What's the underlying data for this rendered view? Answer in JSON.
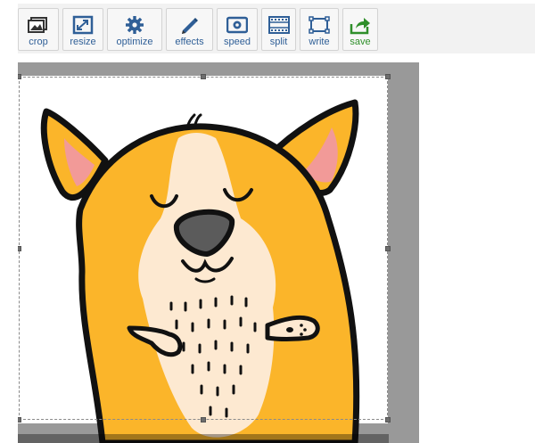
{
  "toolbar": {
    "tools": [
      {
        "id": "crop",
        "label": "crop",
        "icon": "crop-image-icon"
      },
      {
        "id": "resize",
        "label": "resize",
        "icon": "resize-arrows-icon"
      },
      {
        "id": "optimize",
        "label": "optimize",
        "icon": "gear-icon"
      },
      {
        "id": "effects",
        "label": "effects",
        "icon": "pencil-icon"
      },
      {
        "id": "speed",
        "label": "speed",
        "icon": "play-speed-icon"
      },
      {
        "id": "split",
        "label": "split",
        "icon": "film-strip-icon"
      },
      {
        "id": "write",
        "label": "write",
        "icon": "text-frame-icon"
      },
      {
        "id": "save",
        "label": "save",
        "icon": "save-export-icon"
      }
    ]
  },
  "colors": {
    "toolbar_bg": "#f2f2f2",
    "label_blue": "#2f5f97",
    "save_green": "#2f8f2a",
    "workspace_gray": "#999999",
    "dog_orange": "#fbb52a",
    "dog_cream": "#fde9d1",
    "ear_pink": "#f29a98",
    "outline": "#111111"
  },
  "canvas": {
    "image": "corgi-sticker-image",
    "crop_selection": "active"
  }
}
